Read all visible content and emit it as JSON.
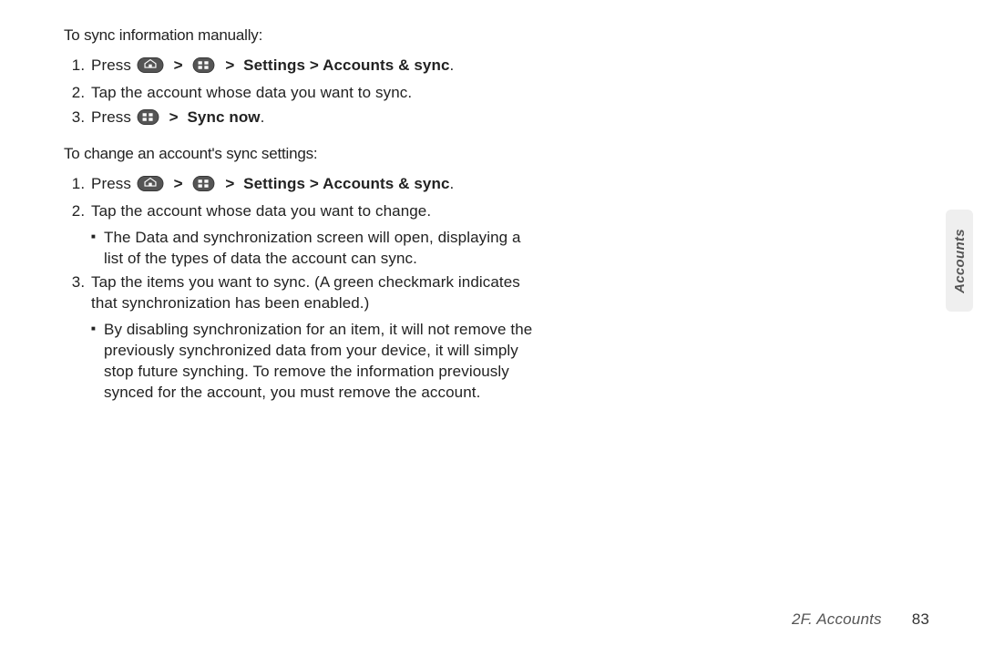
{
  "headings": {
    "sync_manual": "To sync information manually:",
    "change_settings": "To change an account's sync settings:"
  },
  "steps_sync": {
    "s1_press": "Press",
    "s1_path": "Settings > Accounts & sync",
    "s2": "Tap the account whose data you want to sync.",
    "s3_press": "Press",
    "s3_action": "Sync now"
  },
  "steps_change": {
    "s1_press": "Press",
    "s1_path": "Settings > Accounts & sync",
    "s2": "Tap the account whose data you want to change.",
    "s2_bullet": "The Data and synchronization screen will open, displaying a list of the types of data the account can sync.",
    "s3": "Tap the items you want to sync. (A green checkmark indicates that synchronization has been enabled.)",
    "s3_bullet": "By disabling synchronization for an item, it will not remove the previously synchronized data from your device, it will simply stop future synching. To remove the information previously synced for the account, you must remove the account."
  },
  "glyphs": {
    "gt": ">"
  },
  "side_tab": "Accounts",
  "footer": {
    "section": "2F. Accounts",
    "page": "83"
  }
}
